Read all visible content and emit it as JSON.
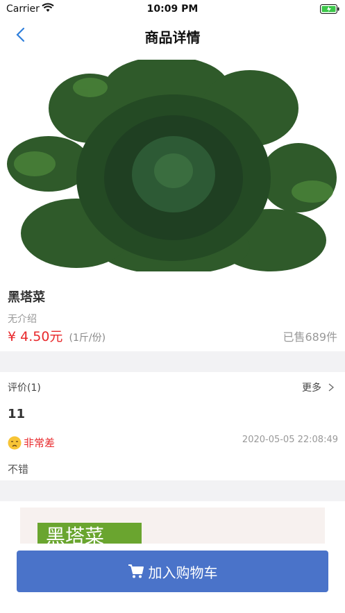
{
  "status": {
    "carrier": "Carrier",
    "time": "10:09 PM"
  },
  "nav": {
    "title": "商品详情"
  },
  "product": {
    "name": "黑塔菜",
    "description": "无介绍",
    "price": "¥ 4.50元",
    "unit": "(1斤/份)",
    "sold": "已售689件"
  },
  "reviews": {
    "header": "评价(1)",
    "more": "更多",
    "items": [
      {
        "user": "11",
        "rating": "非常差",
        "time": "2020-05-05 22:08:49",
        "content": "不错"
      }
    ]
  },
  "detail": {
    "banner_text": "黑塔菜"
  },
  "cart": {
    "label": "加入购物车"
  },
  "colors": {
    "accent": "#4a73c9",
    "price": "#e8282b",
    "leaf": "#2f5a2a"
  }
}
